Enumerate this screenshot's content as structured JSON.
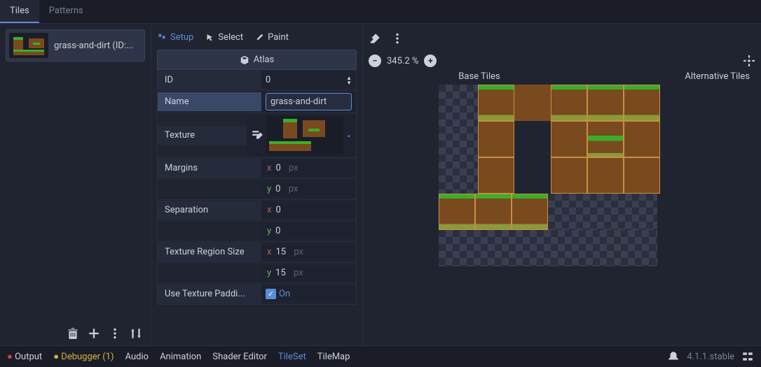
{
  "top_tabs": {
    "tiles": "Tiles",
    "patterns": "Patterns"
  },
  "tile_item": {
    "label": "grass-and-dirt (ID:..."
  },
  "modes": {
    "setup": "Setup",
    "select": "Select",
    "paint": "Paint"
  },
  "atlas": {
    "header": "Atlas",
    "id_label": "ID",
    "id_value": "0",
    "name_label": "Name",
    "name_value": "grass-and-dirt",
    "texture_label": "Texture",
    "margins_label": "Margins",
    "margins_x": "0",
    "margins_y": "0",
    "separation_label": "Separation",
    "sep_x": "0",
    "sep_y": "0",
    "region_label": "Texture Region Size",
    "region_x": "15",
    "region_y": "15",
    "padding_label": "Use Texture Paddi...",
    "padding_on": "On",
    "px": "px"
  },
  "viewer": {
    "zoom": "345.2 %",
    "base_header": "Base Tiles",
    "alt_header": "Alternative Tiles"
  },
  "bottom": {
    "output": "Output",
    "debugger": "Debugger (1)",
    "audio": "Audio",
    "animation": "Animation",
    "shader": "Shader Editor",
    "tileset": "TileSet",
    "tilemap": "TileMap",
    "version": "4.1.1.stable"
  }
}
